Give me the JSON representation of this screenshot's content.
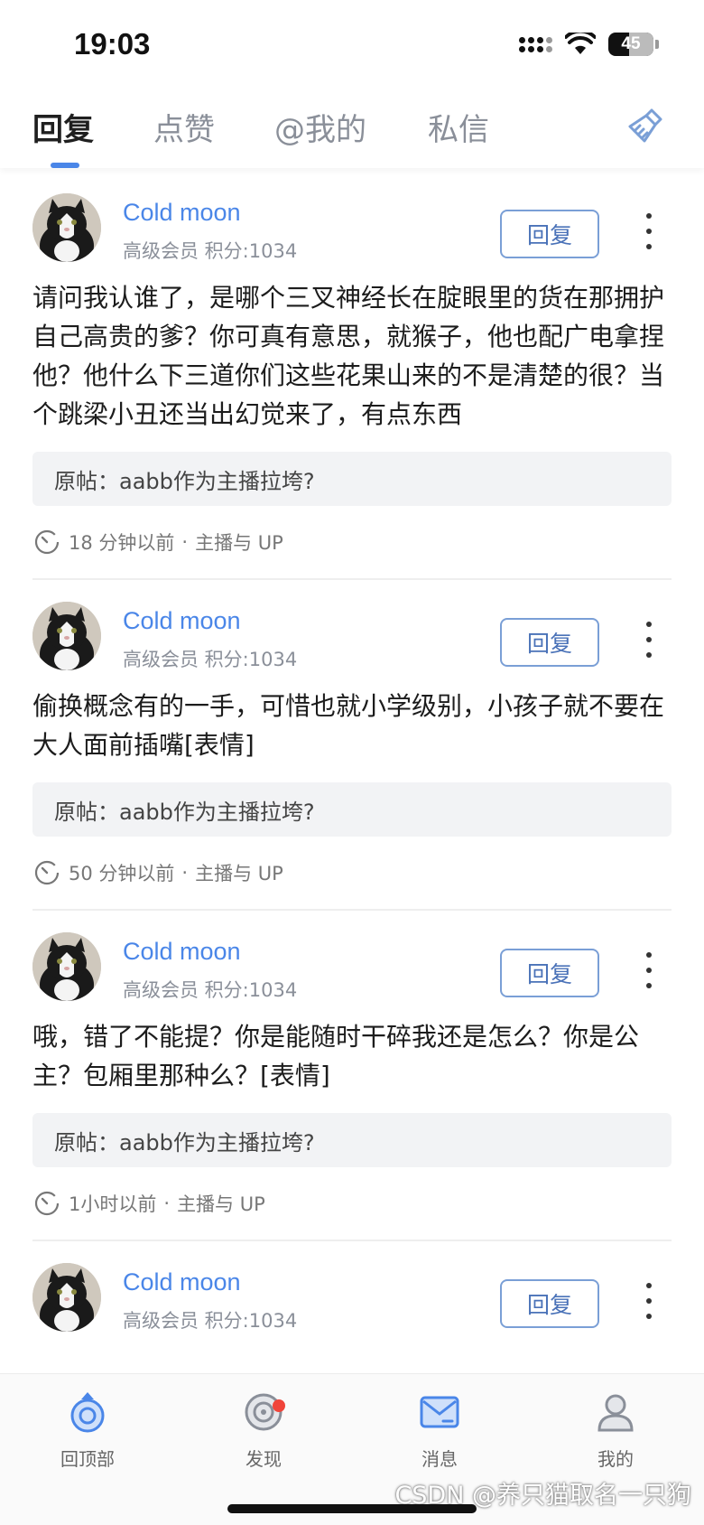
{
  "status_bar": {
    "time": "19:03",
    "battery": "45"
  },
  "tabs": [
    {
      "label": "回复",
      "active": true
    },
    {
      "label": "点赞",
      "active": false
    },
    {
      "label": "@我的",
      "active": false
    },
    {
      "label": "私信",
      "active": false
    }
  ],
  "items": [
    {
      "username": "Cold moon",
      "meta": "高级会员 积分:1034",
      "reply_label": "回复",
      "content": "请问我认谁了，是哪个三叉神经长在腚眼里的货在那拥护自己高贵的爹？你可真有意思，就猴子，他也配广电拿捏他？他什么下三道你们这些花果山来的不是清楚的很？当个跳梁小丑还当出幻觉来了，有点东西",
      "original_post": "原帖：aabb作为主播拉垮?",
      "time": "18 分钟以前",
      "category": "主播与 UP"
    },
    {
      "username": "Cold moon",
      "meta": "高级会员 积分:1034",
      "reply_label": "回复",
      "content": "偷换概念有的一手，可惜也就小学级别，小孩子就不要在大人面前插嘴[表情]",
      "original_post": "原帖：aabb作为主播拉垮?",
      "time": "50 分钟以前",
      "category": "主播与 UP"
    },
    {
      "username": "Cold moon",
      "meta": "高级会员 积分:1034",
      "reply_label": "回复",
      "content": "哦，错了不能提？你是能随时干碎我还是怎么？你是公主？包厢里那种么？[表情]",
      "original_post": "原帖：aabb作为主播拉垮?",
      "time": "1小时以前",
      "category": "主播与 UP"
    },
    {
      "username": "Cold moon",
      "meta": "高级会员 积分:1034",
      "reply_label": "回复"
    }
  ],
  "footer_separator": "·",
  "bottom_nav": [
    {
      "label": "回顶部",
      "icon": "back-to-top-icon"
    },
    {
      "label": "发现",
      "icon": "discover-icon"
    },
    {
      "label": "消息",
      "icon": "message-icon",
      "active": true
    },
    {
      "label": "我的",
      "icon": "profile-icon"
    }
  ],
  "watermark": "CSDN @养只猫取名一只狗",
  "colors": {
    "accent": "#4a86e8",
    "badge": "#f0443a"
  }
}
